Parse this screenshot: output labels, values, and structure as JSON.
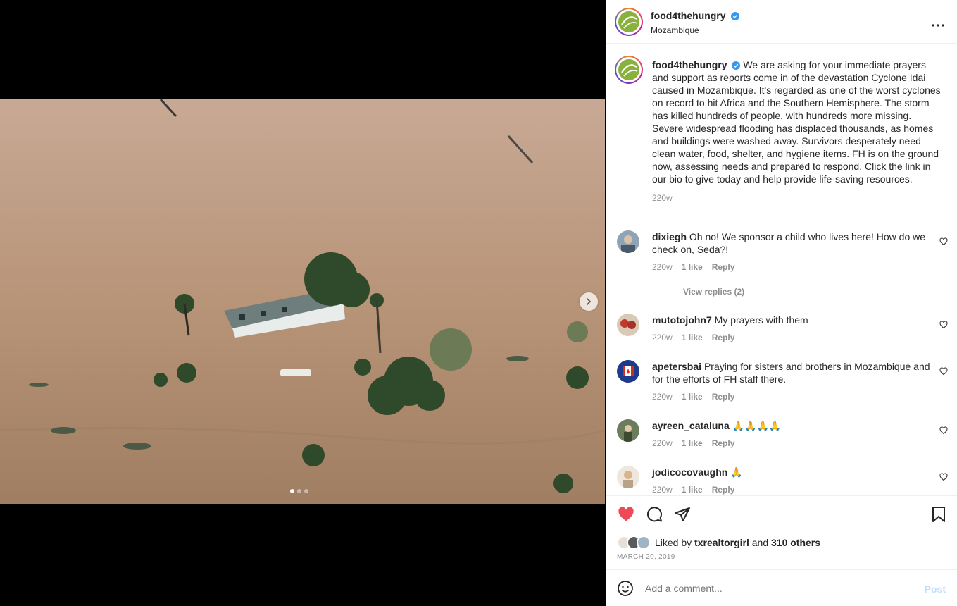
{
  "post": {
    "username": "food4thehungry",
    "location": "Mozambique",
    "more_icon": "more-horizontal-icon",
    "caption": "We are asking for your immediate prayers and support as reports come in of the devastation Cyclone Idai caused in Mozambique. It's regarded as one of the worst cyclones on record to hit Africa and the Southern Hemisphere. The storm has killed hundreds of people, with hundreds more missing. Severe widespread flooding has displaced thousands, as homes and buildings were washed away. Survivors desperately need clean water, food, shelter, and hygiene items. FH is on the ground now, assessing needs and prepared to respond. Click the link in our bio to give today and help provide life-saving resources.",
    "caption_age": "220w"
  },
  "carousel": {
    "slide_count": 3,
    "active_index": 0
  },
  "comments": [
    {
      "user": "dixiegh",
      "text": "Oh no! We sponsor a child who lives here! How do we check on, Seda?!",
      "age": "220w",
      "likes": "1 like",
      "reply": "Reply",
      "view_replies": "View replies (2)"
    },
    {
      "user": "mutotojohn7",
      "text": "My prayers with them",
      "age": "220w",
      "likes": "1 like",
      "reply": "Reply"
    },
    {
      "user": "apetersbai",
      "text": "Praying for sisters and brothers in Mozambique and for the efforts of FH staff there.",
      "age": "220w",
      "likes": "1 like",
      "reply": "Reply"
    },
    {
      "user": "ayreen_cataluna",
      "text": "🙏🙏🙏🙏",
      "age": "220w",
      "likes": "1 like",
      "reply": "Reply"
    },
    {
      "user": "jodicocovaughn",
      "text": "🙏",
      "age": "220w",
      "likes": "1 like",
      "reply": "Reply"
    }
  ],
  "actions": {
    "liked": true,
    "likes_prefix": "Liked by",
    "liked_by_user": "txrealtorgirl",
    "likes_and": "and",
    "others": "310 others",
    "date": "MARCH 20, 2019"
  },
  "composer": {
    "placeholder": "Add a comment...",
    "post_label": "Post"
  },
  "colors": {
    "like_red": "#ed4956",
    "verified_blue": "#3897f0",
    "post_disabled": "#c0dffd"
  }
}
